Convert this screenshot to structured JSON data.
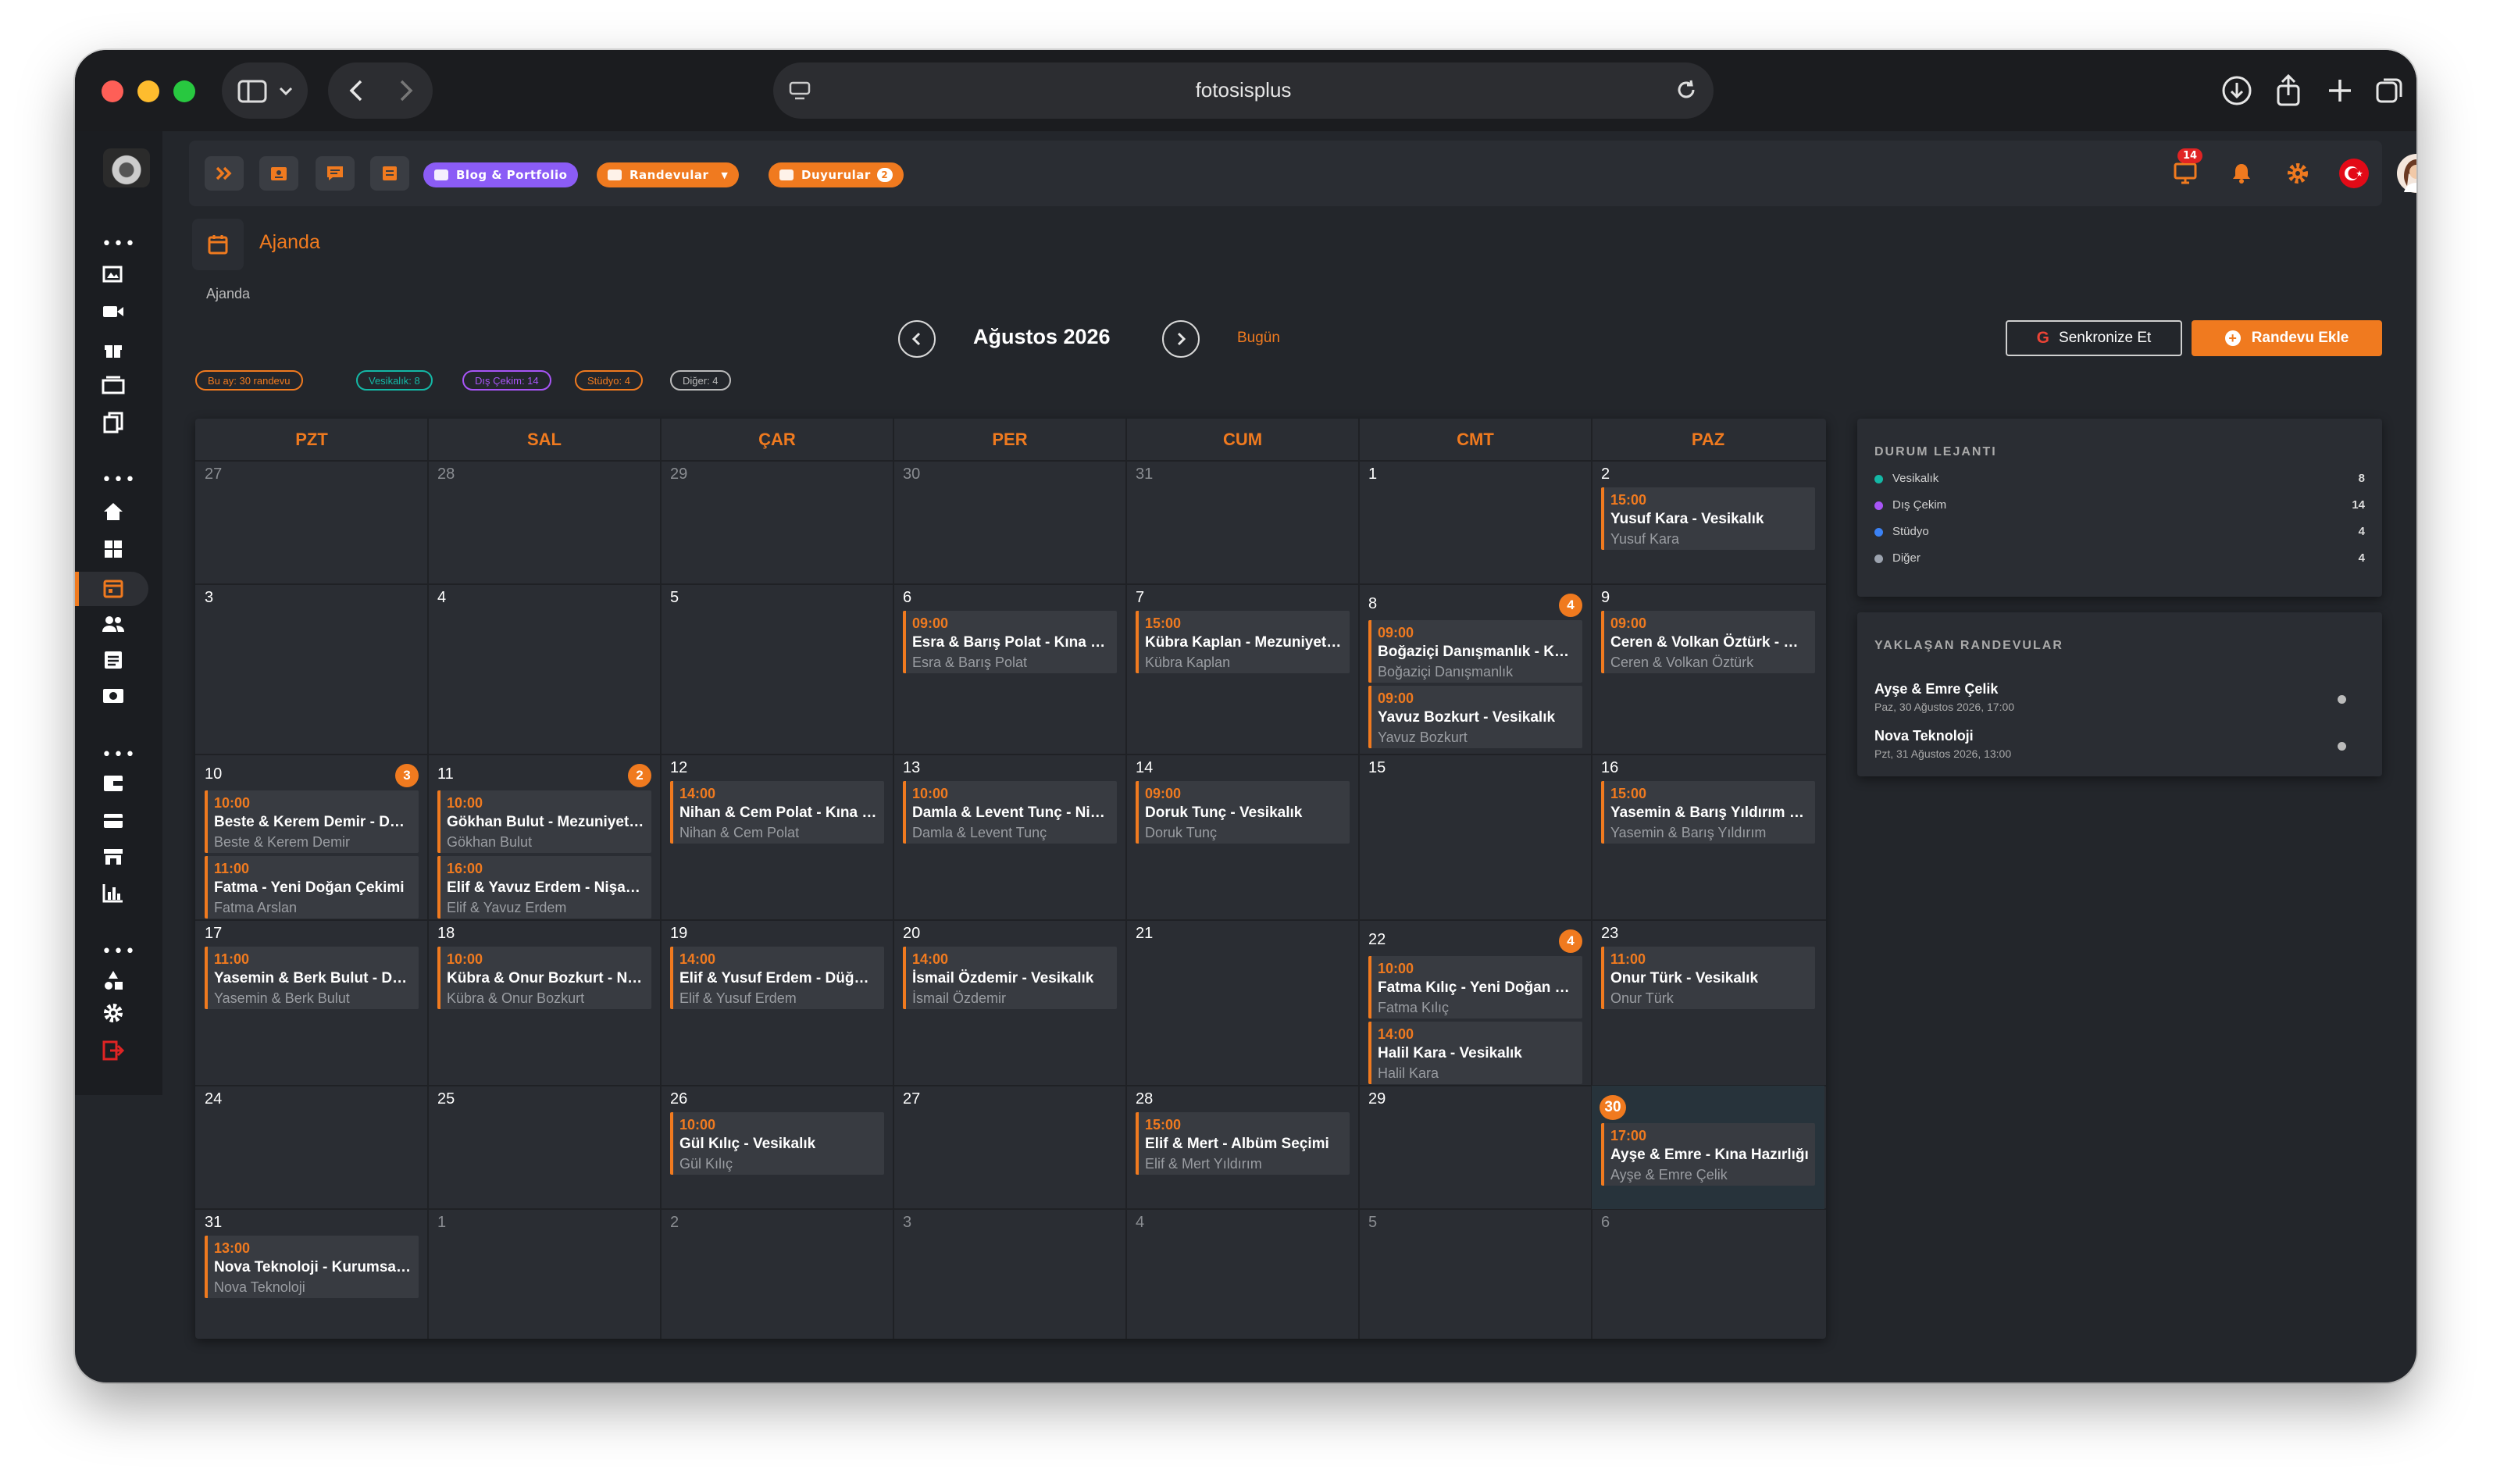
{
  "browser": {
    "url": "fotosisplus"
  },
  "topbar": {
    "pills": [
      {
        "label": "Blog & Portfolio",
        "color": "#8b5cf6"
      },
      {
        "label": "Randevular",
        "color": "#f07a1f"
      },
      {
        "label": "Duyurular",
        "color": "#f07a1f",
        "count": "2"
      }
    ],
    "notifications_count": "14"
  },
  "page": {
    "title": "Ajanda",
    "breadcrumb": "Ajanda",
    "month_label": "Ağustos 2026",
    "today_label": "Bugün",
    "sync_label": "Senkronize Et",
    "add_label": "Randevu Ekle"
  },
  "stats": [
    {
      "label": "Bu ay: 30 randevu",
      "color": "#f07a1f"
    },
    {
      "label": "Vesikalık: 8",
      "color": "#14b8a6"
    },
    {
      "label": "Dış Çekim: 14",
      "color": "#a855f7"
    },
    {
      "label": "Stüdyo: 4",
      "color": "#f07a1f"
    },
    {
      "label": "Diğer: 4",
      "color": "#bbbbbb"
    }
  ],
  "calendar": {
    "weekdays": [
      "PZT",
      "SAL",
      "ÇAR",
      "PER",
      "CUM",
      "CMT",
      "PAZ"
    ],
    "weeks": [
      [
        {
          "day": "27",
          "dim": true,
          "events": []
        },
        {
          "day": "28",
          "dim": true,
          "events": []
        },
        {
          "day": "29",
          "dim": true,
          "events": []
        },
        {
          "day": "30",
          "dim": true,
          "events": []
        },
        {
          "day": "31",
          "dim": true,
          "events": []
        },
        {
          "day": "1",
          "events": []
        },
        {
          "day": "2",
          "events": [
            {
              "time": "15:00",
              "title": "Yusuf Kara - Vesikalık",
              "client": "Yusuf Kara"
            }
          ]
        }
      ],
      [
        {
          "day": "3",
          "events": []
        },
        {
          "day": "4",
          "events": []
        },
        {
          "day": "5",
          "events": []
        },
        {
          "day": "6",
          "events": [
            {
              "time": "09:00",
              "title": "Esra & Barış Polat - Kına Gecesi",
              "client": "Esra & Barış Polat"
            }
          ]
        },
        {
          "day": "7",
          "events": [
            {
              "time": "15:00",
              "title": "Kübra Kaplan - Mezuniyet Çekimi",
              "client": "Kübra Kaplan"
            }
          ]
        },
        {
          "day": "8",
          "badge": "4",
          "events": [
            {
              "time": "09:00",
              "title": "Boğaziçi Danışmanlık - Kurumsal",
              "client": "Boğaziçi Danışmanlık"
            },
            {
              "time": "09:00",
              "title": "Yavuz Bozkurt - Vesikalık",
              "client": "Yavuz Bozkurt"
            }
          ]
        },
        {
          "day": "9",
          "events": [
            {
              "time": "09:00",
              "title": "Ceren & Volkan Öztürk - Düğün",
              "client": "Ceren & Volkan Öztürk"
            }
          ]
        }
      ],
      [
        {
          "day": "10",
          "badge": "3",
          "events": [
            {
              "time": "10:00",
              "title": "Beste & Kerem Demir - Düğün",
              "client": "Beste & Kerem Demir"
            },
            {
              "time": "11:00",
              "title": "Fatma - Yeni Doğan Çekimi",
              "client": "Fatma Arslan"
            }
          ]
        },
        {
          "day": "11",
          "badge": "2",
          "events": [
            {
              "time": "10:00",
              "title": "Gökhan Bulut - Mezuniyet Çekimi",
              "client": "Gökhan Bulut"
            },
            {
              "time": "16:00",
              "title": "Elif & Yavuz Erdem - Nişan Çekimi",
              "client": "Elif & Yavuz Erdem"
            }
          ]
        },
        {
          "day": "12",
          "events": [
            {
              "time": "14:00",
              "title": "Nihan & Cem Polat - Kına Gecesi",
              "client": "Nihan & Cem Polat"
            }
          ]
        },
        {
          "day": "13",
          "events": [
            {
              "time": "10:00",
              "title": "Damla & Levent Tunç - Nişan Çekimi",
              "client": "Damla & Levent Tunç"
            }
          ]
        },
        {
          "day": "14",
          "events": [
            {
              "time": "09:00",
              "title": "Doruk Tunç - Vesikalık",
              "client": "Doruk Tunç"
            }
          ]
        },
        {
          "day": "15",
          "events": []
        },
        {
          "day": "16",
          "events": [
            {
              "time": "15:00",
              "title": "Yasemin & Barış Yıldırım - Düğün",
              "client": "Yasemin & Barış Yıldırım"
            }
          ]
        }
      ],
      [
        {
          "day": "17",
          "events": [
            {
              "time": "11:00",
              "title": "Yasemin & Berk Bulut - Düğün",
              "client": "Yasemin & Berk Bulut"
            }
          ]
        },
        {
          "day": "18",
          "events": [
            {
              "time": "10:00",
              "title": "Kübra & Onur Bozkurt - Nişan",
              "client": "Kübra & Onur Bozkurt"
            }
          ]
        },
        {
          "day": "19",
          "events": [
            {
              "time": "14:00",
              "title": "Elif & Yusuf Erdem - Düğün Çekimi",
              "client": "Elif & Yusuf Erdem"
            }
          ]
        },
        {
          "day": "20",
          "events": [
            {
              "time": "14:00",
              "title": "İsmail Özdemir - Vesikalık",
              "client": "İsmail Özdemir"
            }
          ]
        },
        {
          "day": "21",
          "events": []
        },
        {
          "day": "22",
          "badge": "4",
          "events": [
            {
              "time": "10:00",
              "title": "Fatma Kılıç - Yeni Doğan Çekimi",
              "client": "Fatma Kılıç"
            },
            {
              "time": "14:00",
              "title": "Halil Kara - Vesikalık",
              "client": "Halil Kara"
            }
          ]
        },
        {
          "day": "23",
          "events": [
            {
              "time": "11:00",
              "title": "Onur Türk - Vesikalık",
              "client": "Onur Türk"
            }
          ]
        }
      ],
      [
        {
          "day": "24",
          "events": []
        },
        {
          "day": "25",
          "events": []
        },
        {
          "day": "26",
          "events": [
            {
              "time": "10:00",
              "title": "Gül Kılıç - Vesikalık",
              "client": "Gül Kılıç"
            }
          ]
        },
        {
          "day": "27",
          "events": []
        },
        {
          "day": "28",
          "events": [
            {
              "time": "15:00",
              "title": "Elif & Mert - Albüm Seçimi",
              "client": "Elif & Mert Yıldırım"
            }
          ]
        },
        {
          "day": "29",
          "events": []
        },
        {
          "day": "30",
          "today": true,
          "events": [
            {
              "time": "17:00",
              "title": "Ayşe & Emre - Kına Hazırlığı",
              "client": "Ayşe & Emre Çelik"
            }
          ]
        }
      ],
      [
        {
          "day": "31",
          "events": [
            {
              "time": "13:00",
              "title": "Nova Teknoloji - Kurumsal Çekim",
              "client": "Nova Teknoloji"
            }
          ]
        },
        {
          "day": "1",
          "dim": true,
          "events": []
        },
        {
          "day": "2",
          "dim": true,
          "events": []
        },
        {
          "day": "3",
          "dim": true,
          "events": []
        },
        {
          "day": "4",
          "dim": true,
          "events": []
        },
        {
          "day": "5",
          "dim": true,
          "events": []
        },
        {
          "day": "6",
          "dim": true,
          "events": []
        }
      ]
    ]
  },
  "legend": {
    "title": "DURUM LEJANTI",
    "items": [
      {
        "label": "Vesikalık",
        "count": "8",
        "color": "#14b8a6"
      },
      {
        "label": "Dış Çekim",
        "count": "14",
        "color": "#a855f7"
      },
      {
        "label": "Stüdyo",
        "count": "4",
        "color": "#3b82f6"
      },
      {
        "label": "Diğer",
        "count": "4",
        "color": "#9ca3af"
      }
    ]
  },
  "upcoming": {
    "title": "YAKLAŞAN RANDEVULAR",
    "items": [
      {
        "name": "Ayşe & Emre Çelik",
        "date": "Paz, 30 Ağustos 2026, 17:00"
      },
      {
        "name": "Nova Teknoloji",
        "date": "Pzt, 31 Ağustos 2026, 13:00"
      }
    ]
  }
}
